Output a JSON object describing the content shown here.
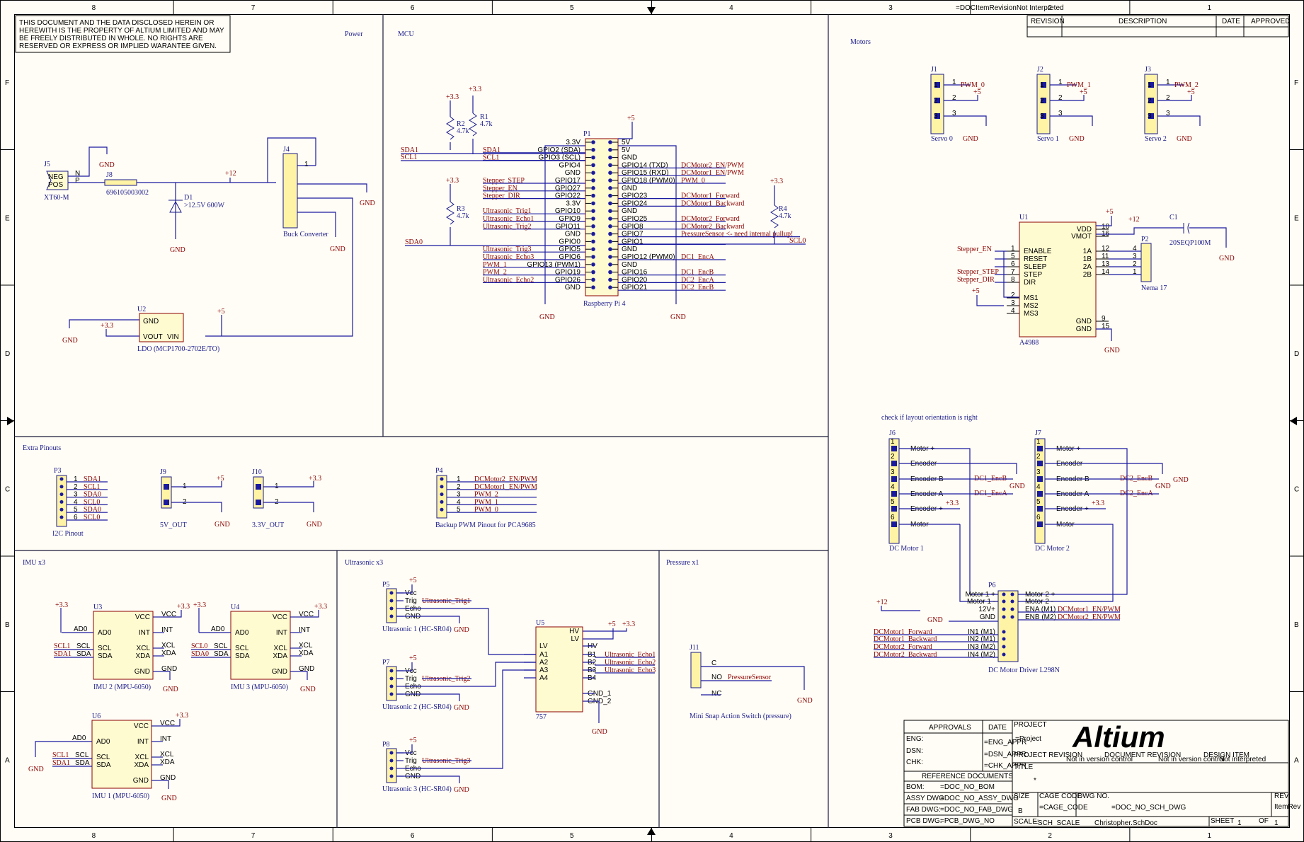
{
  "border": {
    "top_cols": [
      "8",
      "7",
      "6",
      "5",
      "4",
      "3",
      "2",
      "1"
    ],
    "rows": [
      "F",
      "E",
      "D",
      "C",
      "B",
      "A"
    ]
  },
  "notice": [
    "THIS DOCUMENT AND THE DATA DISCLOSED HEREIN OR",
    "HEREWITH IS THE PROPERTY OF ALTIUM LIMITED AND MAY",
    "BE FREELY DISTRIBUTED IN WHOLE. NO RIGHTS ARE",
    "RESERVED OR EXPRESS OR IMPLIED WARANTEE GIVEN."
  ],
  "revision_table": {
    "revision": "REVISION",
    "description": "DESCRIPTION",
    "date": "DATE",
    "approved": "APPROVED",
    "top_note": "=DOCItemRevisionNot Interpreted"
  },
  "sections": {
    "power": "Power",
    "mcu": "MCU",
    "motors": "Motors",
    "extra": "Extra Pinouts",
    "imu": "IMU x3",
    "ultrasonic": "Ultrasonic x3",
    "pressure": "Pressure x1",
    "check": "check if layout orientation is right"
  },
  "power": {
    "j5": "J5",
    "j5_sub": "XT60-M",
    "neg": "NEG",
    "pos": "POS",
    "n": "N",
    "p": "P",
    "j8": "J8",
    "j8_part": "696105003002",
    "d1": "D1",
    "d1_val": ">12.5V 600W",
    "plus12": "+12",
    "gnd": "GND",
    "j4": "J4",
    "j4_sub": "Buck Converter",
    "u2": "U2",
    "u2_gnd": "GND",
    "u2_vout": "VOUT",
    "u2_vin": "VIN",
    "u2_sub": "LDO (MCP1700-2702E/TO)",
    "plus33": "+3.3",
    "plus5": "+5"
  },
  "mcu": {
    "p1": "P1",
    "p1_sub": "Raspberry Pi 4",
    "left_pins": [
      "3.3V",
      "GPIO2 (SDA)",
      "GPIO3 (SCL)",
      "GPIO4",
      "GND",
      "GPIO17",
      "GPIO27",
      "GPIO22",
      "3.3V",
      "GPIO10",
      "GPIO9",
      "GPIO11",
      "GND",
      "GPIO0",
      "GPIO5",
      "GPIO6",
      "GPIO13 (PWM1)",
      "GPIO19",
      "GPIO26",
      "GND"
    ],
    "right_pins": [
      "5V",
      "5V",
      "GND",
      "GPIO14 (TXD)",
      "GPIO15 (RXD)",
      "GPIO18 (PWM0)",
      "GND",
      "GPIO23",
      "GPIO24",
      "GND",
      "GPIO25",
      "GPIO8",
      "GPIO7",
      "GPIO1",
      "GND",
      "GPIO12 (PWM0)",
      "GND",
      "GPIO16",
      "GPIO20",
      "GPIO21"
    ],
    "left_nets": [
      "",
      "SDA1",
      "SCL1",
      "",
      "",
      "Stepper_STEP",
      "Stepper_EN",
      "Stepper_DIR",
      "",
      "Ultrasonic_Trig1",
      "Ultrasonic_Echo1",
      "Ultrasonic_Trig2",
      "",
      "",
      "Ultrasonic_Trig3",
      "Ultrasonic_Echo3",
      "PWM_1",
      "PWM_2",
      "Ultrasonic_Echo2",
      ""
    ],
    "right_nets": [
      "",
      "",
      "",
      "DCMotor2_EN/PWM",
      "DCMotor1_EN/PWM",
      "PWM_0",
      "",
      "DCMotor1_Forward",
      "DCMotor1_Backward",
      "",
      "DCMotor2_Forward",
      "DCMotor2_Backward",
      "PressureSensor  <- need internal pullup!",
      "SCL0",
      "",
      "DC1_EncA",
      "",
      "DC1_EncB",
      "DC2_EncA",
      "DC2_EncB"
    ],
    "r1": "R1",
    "r1_val": "4.7k",
    "r2": "R2",
    "r2_val": "4.7k",
    "r3": "R3",
    "r3_val": "4.7k",
    "r4": "R4",
    "r4_val": "4.7k",
    "sda1": "SDA1",
    "scl1": "SCL1",
    "sda0": "SDA0",
    "scl0": "SCL0",
    "plus33": "+3.3",
    "plus5": "+5",
    "gnd": "GND",
    "one": "1",
    "two": "2"
  },
  "motors": {
    "servos": [
      {
        "ref": "J1",
        "sub": "Servo 0",
        "pwm": "PWM_0"
      },
      {
        "ref": "J2",
        "sub": "Servo 1",
        "pwm": "PWM_1"
      },
      {
        "ref": "J3",
        "sub": "Servo 2",
        "pwm": "PWM_2"
      }
    ],
    "u1": "U1",
    "u1_sub": "A4988",
    "u1_left": [
      "ENABLE",
      "RESET",
      "SLEEP",
      "STEP",
      "DIR",
      "MS1",
      "MS2",
      "MS3"
    ],
    "u1_left_nums": [
      "1",
      "5",
      "6",
      "7",
      "8",
      "2",
      "3",
      "4"
    ],
    "u1_right": [
      "VDD",
      "VMOT",
      "1A",
      "1B",
      "2A",
      "2B",
      "GND",
      "GND"
    ],
    "u1_right_nums": [
      "10",
      "16",
      "12",
      "11",
      "13",
      "14",
      "9",
      "15"
    ],
    "stepper_en": "Stepper_EN",
    "stepper_step": "Stepper_STEP",
    "stepper_dir": "Stepper_DIR",
    "p2": "P2",
    "p2_sub": "Nema 17",
    "p2_nums": [
      "4",
      "3",
      "2",
      "1"
    ],
    "c1": "C1",
    "c1_sub": "20SEQP100M",
    "plus5": "+5",
    "plus12": "+12",
    "plus33": "+3.3",
    "gnd": "GND",
    "j6": "J6",
    "j6_sub": "DC Motor 1",
    "j7": "J7",
    "j7_sub": "DC Motor 2",
    "dc_pins": [
      "Motor +",
      "Encoder -",
      "Encoder B",
      "Encoder A",
      "Encoder +",
      "Motor -"
    ],
    "dc1_encb": "DC1_EncB",
    "dc1_enca": "DC1_EncA",
    "dc2_encb": "DC2_EncB",
    "dc2_enca": "DC2_EncA",
    "p6": "P6",
    "p6_sub": "DC Motor Driver L298N",
    "p6_left": [
      "Motor 1 +",
      "Motor 1 -",
      "12V+",
      "GND",
      "IN1 (M1)",
      "IN2 (M1)",
      "IN3 (M2)",
      "IN4 (M2)"
    ],
    "p6_right": [
      "Motor 2 +",
      "Motor 2 -",
      "ENA (M1)",
      "ENB (M2)"
    ],
    "p6_left_nets": [
      "DCMotor1_Forward",
      "DCMotor1_Backward",
      "DCMotor2_Forward",
      "DCMotor2_Backward"
    ],
    "p6_right_nets": [
      "DCMotor1_EN/PWM",
      "DCMotor2_EN/PWM"
    ]
  },
  "extra": {
    "p3": "P3",
    "p3_sub": "I2C Pinout",
    "p3_nets": [
      "SDA1",
      "SCL1",
      "SDA0",
      "SCL0",
      "SDA0",
      "SCL0"
    ],
    "j9": "J9",
    "j9_sub": "5V_OUT",
    "j10": "J10",
    "j10_sub": "3.3V_OUT",
    "p4": "P4",
    "p4_sub": "Backup PWM Pinout for PCA9685",
    "p4_nets": [
      "DCMotor2_EN/PWM",
      "DCMotor1_EN/PWM",
      "PWM_2",
      "PWM_1",
      "PWM_0"
    ],
    "plus5": "+5",
    "plus33": "+3.3",
    "gnd": "GND"
  },
  "imu": {
    "units": [
      {
        "ref": "U3",
        "sub": "IMU 2 (MPU-6050)",
        "scl": "SCL1",
        "sda": "SDA1"
      },
      {
        "ref": "U4",
        "sub": "IMU 3 (MPU-6050)",
        "scl": "SCL0",
        "sda": "SDA0"
      },
      {
        "ref": "U6",
        "sub": "IMU 1 (MPU-6050)",
        "scl": "SCL1",
        "sda": "SDA1"
      }
    ],
    "pins_left": [
      "AD0",
      "SCL",
      "SDA"
    ],
    "pins_right": [
      "VCC",
      "INT",
      "XCL",
      "XDA",
      "GND"
    ],
    "ad0": "AD0",
    "plus33": "+3.3",
    "gnd": "GND"
  },
  "ultra": {
    "units": [
      {
        "ref": "P5",
        "sub": "Ultrasonic 1 (HC-SR04)",
        "trig": "Ultrasonic_Trig1"
      },
      {
        "ref": "P7",
        "sub": "Ultrasonic 2 (HC-SR04)",
        "trig": "Ultrasonic_Trig2"
      },
      {
        "ref": "P8",
        "sub": "Ultrasonic 3 (HC-SR04)",
        "trig": "Ultrasonic_Trig3"
      }
    ],
    "pins": [
      "Vcc",
      "Trig",
      "Echo",
      "GND"
    ],
    "u5": "U5",
    "u5_sub": "757",
    "u5_left": [
      "LV",
      "A1",
      "A2",
      "A3",
      "A4"
    ],
    "u5_right": [
      "HV",
      "LV",
      "HV",
      "B1",
      "B2",
      "B3",
      "B4",
      "GND_1",
      "GND_2"
    ],
    "echo_nets": [
      "Ultrasonic_Echo1",
      "Ultrasonic_Echo2",
      "Ultrasonic_Echo3"
    ],
    "hv": "HV",
    "lv": "LV",
    "plus5": "+5",
    "plus33": "+3.3",
    "gnd": "GND"
  },
  "pressure": {
    "j11": "J11",
    "j11_sub": "Mini Snap Action Switch (pressure)",
    "c": "C",
    "no": "NO",
    "nc": "NC",
    "net": "PressureSensor",
    "gnd": "GND"
  },
  "titleblock": {
    "approvals": "APPROVALS",
    "date": "DATE",
    "eng": "ENG:",
    "dsn": "DSN:",
    "chk": "CHK:",
    "eng_appr": "=ENG_APPR",
    "dsn_appr": "=DSN_APPR",
    "chk_appr": "=CHK_APPR",
    "reference": "REFERENCE DOCUMENTS",
    "bom": "BOM:",
    "assy": "ASSY DWG:",
    "fab": "FAB DWG:",
    "pcb": "PCB DWG:",
    "bom_v": "=DOC_NO_BOM",
    "assy_v": "=DOC_NO_ASSY_DWG",
    "fab_v": "=DOC_NO_FAB_DWG",
    "pcb_v": "=PCB_DWG_NO",
    "project": "PROJECT",
    "project_v": "=Project",
    "logo": "Altium",
    "project_rev": "PROJECT REVISION",
    "doc_rev": "DOCUMENT REVISION",
    "design_item": "DESIGN ITEM",
    "not_ctrl": "Not in version control",
    "not_ctrl2": "Not in version control",
    "not_interp": "Not interpreted",
    "title": "TITLE",
    "title_v": "*",
    "size": "SIZE",
    "size_v": "B",
    "cage": "CAGE CODE",
    "cage_v": "=CAGE_CODE",
    "dwg": "DWG NO.",
    "dwg_v": "=DOC_NO_SCH_DWG",
    "rev": "REV",
    "rev_v": "ItemRev",
    "scale": "SCALE:",
    "scale_v": "=SCH_SCALE",
    "filename": "Christopher.SchDoc",
    "sheet": "SHEET",
    "sheet_v": "1",
    "of": "OF",
    "of_v": "1"
  }
}
